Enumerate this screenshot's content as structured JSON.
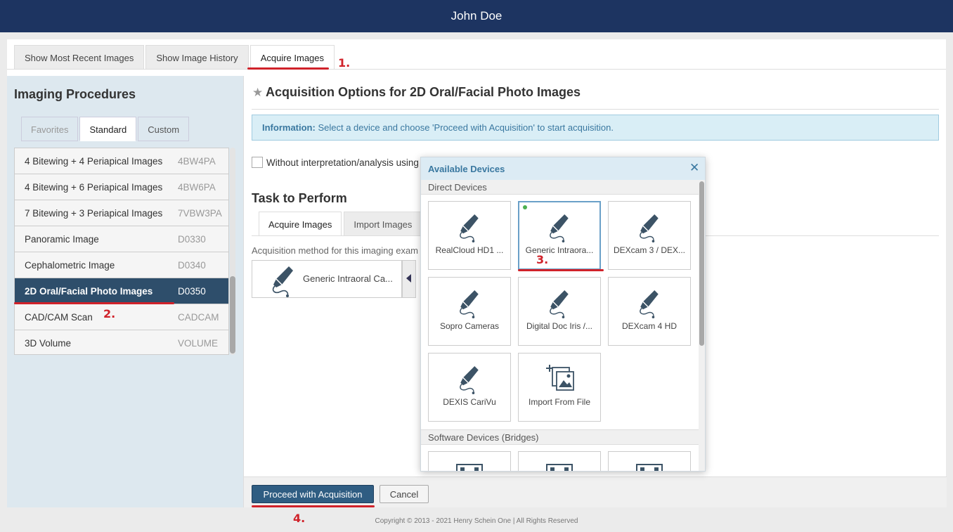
{
  "header": {
    "user_name": "John Doe"
  },
  "top_tabs": [
    {
      "label": "Show Most Recent Images"
    },
    {
      "label": "Show Image History"
    },
    {
      "label": "Acquire Images"
    }
  ],
  "annotations": {
    "step1": "1.",
    "step2": "2.",
    "step3": "3.",
    "step4": "4.",
    "color": "#d0222a"
  },
  "left_panel": {
    "title": "Imaging Procedures",
    "tabs": [
      {
        "label": "Favorites"
      },
      {
        "label": "Standard"
      },
      {
        "label": "Custom"
      }
    ],
    "procedures": [
      {
        "name": "4 Bitewing + 4 Periapical Images",
        "code": "4BW4PA"
      },
      {
        "name": "4 Bitewing + 6 Periapical Images",
        "code": "4BW6PA"
      },
      {
        "name": "7 Bitewing + 3 Periapical Images",
        "code": "7VBW3PA"
      },
      {
        "name": "Panoramic Image",
        "code": "D0330"
      },
      {
        "name": "Cephalometric Image",
        "code": "D0340"
      },
      {
        "name": "2D Oral/Facial Photo Images",
        "code": "D0350"
      },
      {
        "name": "CAD/CAM Scan",
        "code": "CADCAM"
      },
      {
        "name": "3D Volume",
        "code": "VOLUME"
      }
    ]
  },
  "main": {
    "title": "Acquisition Options for 2D Oral/Facial Photo Images",
    "info_label": "Information:",
    "info_text": "Select a device and choose 'Proceed with Acquisition' to start acquisition.",
    "checkbox_label": "Without interpretation/analysis using c",
    "task_title": "Task to Perform",
    "task_tabs": [
      {
        "label": "Acquire Images"
      },
      {
        "label": "Import Images"
      }
    ],
    "method_label": "Acquisition method for this imaging exam",
    "selected_device": "Generic Intraoral Ca...",
    "proceed_label": "Proceed with Acquisition",
    "cancel_label": "Cancel"
  },
  "devices_popup": {
    "title": "Available Devices",
    "close_icon": "close-icon",
    "direct_section": "Direct Devices",
    "direct_devices": [
      {
        "name": "RealCloud HD1 ...",
        "icon": "intraoral-camera-icon"
      },
      {
        "name": "Generic Intraora...",
        "icon": "intraoral-camera-icon"
      },
      {
        "name": "DEXcam 3 / DEX...",
        "icon": "intraoral-camera-icon"
      },
      {
        "name": "Sopro Cameras",
        "icon": "intraoral-camera-icon"
      },
      {
        "name": "Digital Doc Iris /...",
        "icon": "intraoral-camera-icon"
      },
      {
        "name": "DEXcam 4 HD",
        "icon": "intraoral-camera-icon"
      },
      {
        "name": "DEXIS CariVu",
        "icon": "intraoral-camera-icon"
      },
      {
        "name": "Import From File",
        "icon": "import-images-icon"
      }
    ],
    "software_section": "Software Devices (Bridges)"
  },
  "footer": {
    "copyright": "Copyright © 2013 - 2021 Henry Schein One | All Rights Reserved"
  },
  "colors": {
    "header_bg": "#1d3461",
    "selected_row": "#2e4e6b",
    "accent": "#3a78a0",
    "proceed_button": "#2f5d82"
  }
}
